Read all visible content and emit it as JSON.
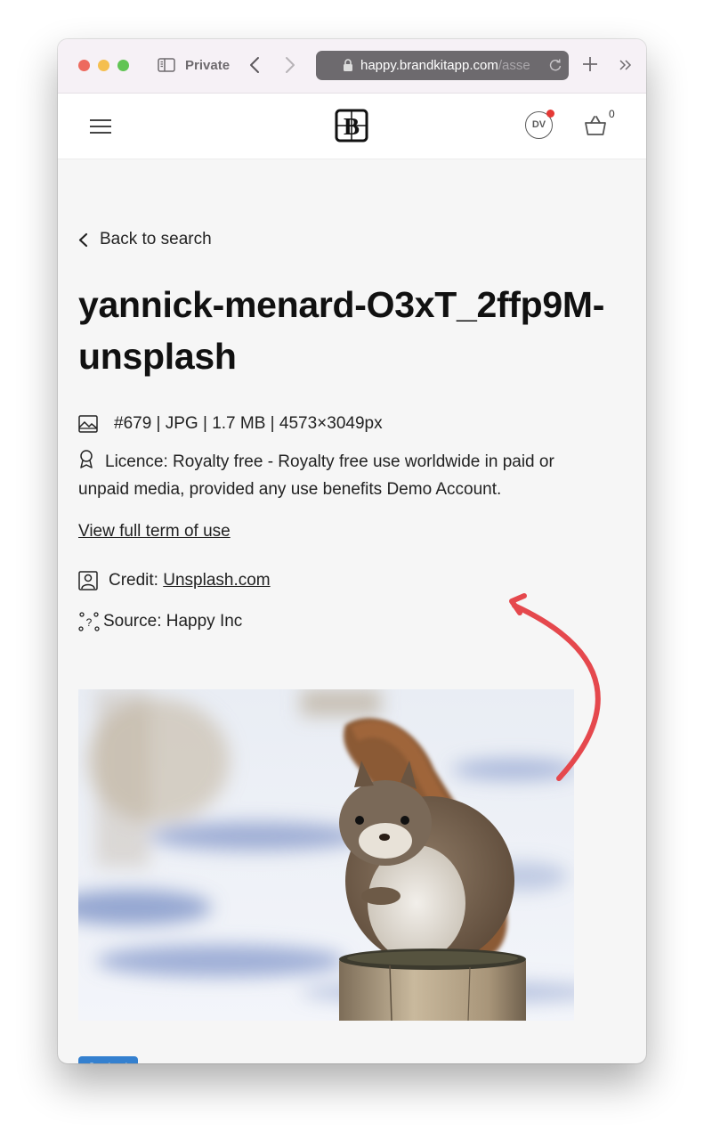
{
  "browser": {
    "private_label": "Private",
    "url_main": "happy.brandkitapp.com",
    "url_dim": "/asse",
    "icons": {
      "sidebar": "sidebar-toggle-icon",
      "back": "chevron-left-icon",
      "forward": "chevron-right-icon",
      "lock": "lock-icon",
      "reload": "reload-icon",
      "new_tab": "plus-icon",
      "more": "double-chevron-right-icon"
    }
  },
  "header": {
    "menu_icon": "hamburger-icon",
    "logo_letter": "B",
    "avatar_initials": "DV",
    "basket_count": "0",
    "notification_color": "#e53935"
  },
  "asset": {
    "back_label": "Back to search",
    "title": "yannick-menard-O3xT_2ffp9M-unsplash",
    "format_line": "#679 | JPG | 1.7 MB | 4573×3049px",
    "licence": "Licence: Royalty free - Royalty free use worldwide in paid or unpaid media, provided any use benefits Demo Account.",
    "terms_link": "View full term of use",
    "credit_label": "Credit: ",
    "credit_link": "Unsplash.com",
    "source": "Source: Happy Inc",
    "image_alt": "Red squirrel sitting on a wooden post in snow",
    "tags": [
      "Squirrel"
    ],
    "tag_color": "#3480cf",
    "partial_text": "syd"
  },
  "annotation": {
    "arrow_color": "#e5484d"
  }
}
